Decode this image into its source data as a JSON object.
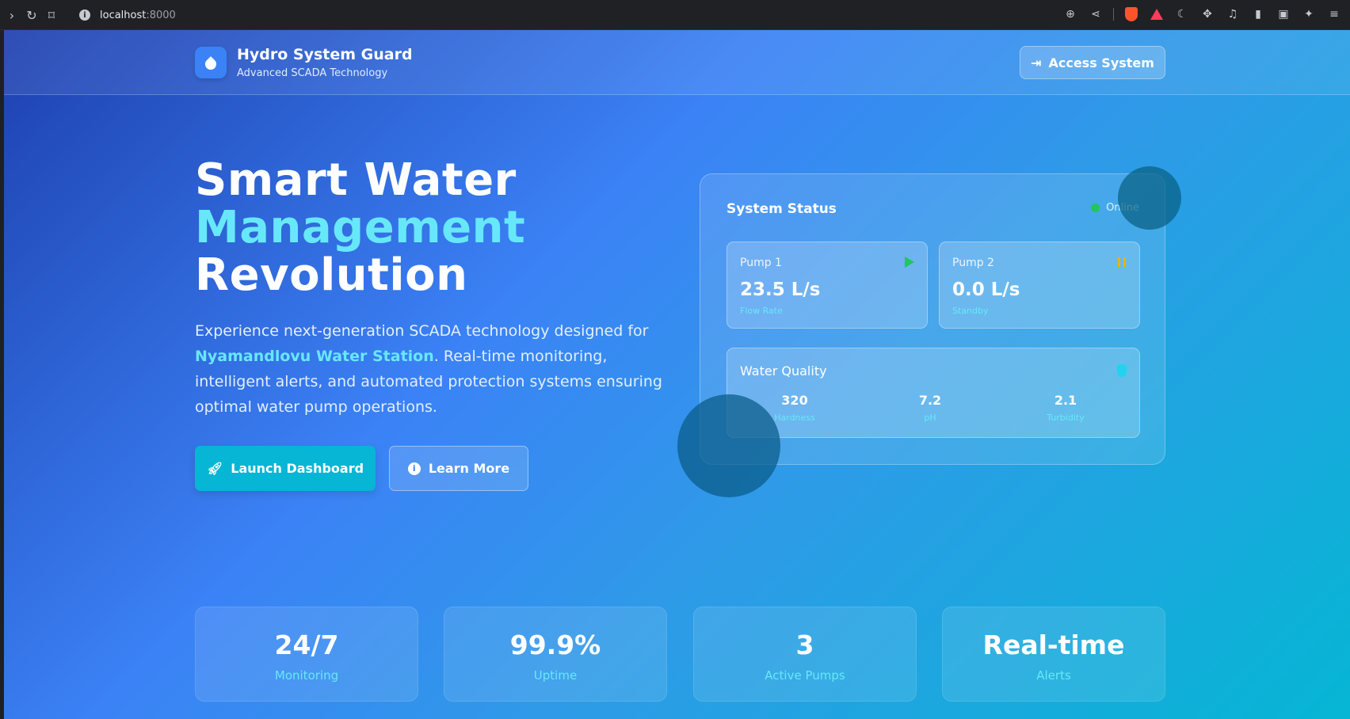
{
  "browser": {
    "url_host": "localhost",
    "url_port": ":8000"
  },
  "nav": {
    "brand_title": "Hydro System Guard",
    "brand_subtitle": "Advanced SCADA Technology",
    "access_label": "Access System"
  },
  "hero": {
    "title_line1": "Smart Water",
    "title_line2": "Management",
    "title_line3": "Revolution",
    "desc_before": "Experience next-generation SCADA technology designed for ",
    "desc_highlight": "Nyamandlovu Water Station",
    "desc_after": ". Real-time monitoring, intelligent alerts, and automated protection systems ensuring optimal water pump operations.",
    "launch_label": "Launch Dashboard",
    "learn_label": "Learn More"
  },
  "status": {
    "title": "System Status",
    "state": "Online",
    "pumps": [
      {
        "name": "Pump 1",
        "value": "23.5 L/s",
        "label": "Flow Rate"
      },
      {
        "name": "Pump 2",
        "value": "0.0 L/s",
        "label": "Standby"
      }
    ],
    "water_quality": {
      "title": "Water Quality",
      "items": [
        {
          "value": "320",
          "label": "Hardness"
        },
        {
          "value": "7.2",
          "label": "pH"
        },
        {
          "value": "2.1",
          "label": "Turbidity"
        }
      ]
    }
  },
  "stats": [
    {
      "value": "24/7",
      "label": "Monitoring"
    },
    {
      "value": "99.9%",
      "label": "Uptime"
    },
    {
      "value": "3",
      "label": "Active Pumps"
    },
    {
      "value": "Real-time",
      "label": "Alerts"
    }
  ],
  "colors": {
    "accent_cyan": "#67e8f9",
    "primary_button": "#06b6d4",
    "online_green": "#22c55e",
    "pause_yellow": "#eab308"
  }
}
